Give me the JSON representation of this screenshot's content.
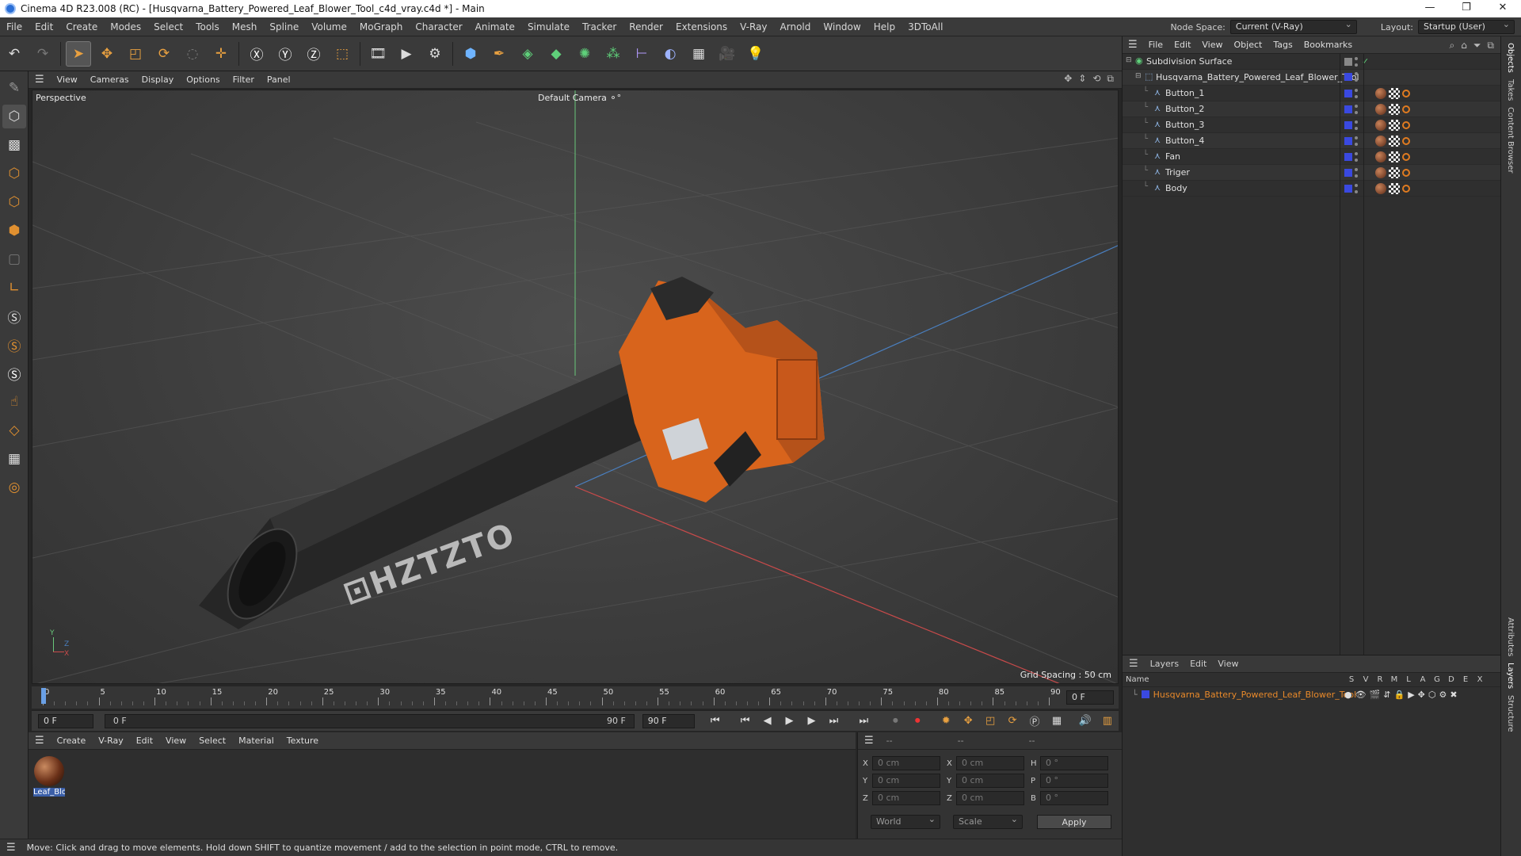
{
  "window": {
    "title": "Cinema 4D R23.008 (RC) - [Husqvarna_Battery_Powered_Leaf_Blower_Tool_c4d_vray.c4d *] - Main",
    "controls": [
      "—",
      "❐",
      "✕"
    ]
  },
  "menubar": {
    "items": [
      "File",
      "Edit",
      "Create",
      "Modes",
      "Select",
      "Tools",
      "Mesh",
      "Spline",
      "Volume",
      "MoGraph",
      "Character",
      "Animate",
      "Simulate",
      "Tracker",
      "Render",
      "Extensions",
      "V-Ray",
      "Arnold",
      "Window",
      "Help",
      "3DToAll"
    ],
    "node_space_label": "Node Space:",
    "node_space_value": "Current (V-Ray)",
    "layout_label": "Layout:",
    "layout_value": "Startup (User)"
  },
  "viewport": {
    "menu": [
      "View",
      "Cameras",
      "Display",
      "Options",
      "Filter",
      "Panel"
    ],
    "view_name": "Perspective",
    "camera_name": "Default Camera",
    "camera_icon": "⚬°",
    "grid_spacing": "Grid Spacing : 50 cm",
    "axis_y": "Y",
    "axis_z": "Z",
    "axis_x": "X"
  },
  "timeline": {
    "ticks": [
      "0",
      "5",
      "10",
      "15",
      "20",
      "25",
      "30",
      "35",
      "40",
      "45",
      "50",
      "55",
      "60",
      "65",
      "70",
      "75",
      "80",
      "85",
      "90"
    ],
    "current_frame": "0 F",
    "start_frame": "0 F",
    "range_start": "0 F",
    "range_end": "90 F",
    "end_frame": "90 F"
  },
  "material": {
    "menu": [
      "Create",
      "V-Ray",
      "Edit",
      "View",
      "Select",
      "Material",
      "Texture"
    ],
    "items": [
      {
        "name": "Leaf_Blo"
      }
    ]
  },
  "coords": {
    "header": [
      "--",
      "--",
      "--"
    ],
    "rows": [
      {
        "a_label": "X",
        "a_val": "0 cm",
        "b_label": "X",
        "b_val": "0 cm",
        "c_label": "H",
        "c_val": "0 °"
      },
      {
        "a_label": "Y",
        "a_val": "0 cm",
        "b_label": "Y",
        "b_val": "0 cm",
        "c_label": "P",
        "c_val": "0 °"
      },
      {
        "a_label": "Z",
        "a_val": "0 cm",
        "b_label": "Z",
        "b_val": "0 cm",
        "c_label": "B",
        "c_val": "0 °"
      }
    ],
    "space": "World",
    "mode": "Scale",
    "apply": "Apply"
  },
  "status": {
    "text": "Move: Click and drag to move elements. Hold down SHIFT to quantize movement / add to the selection in point mode, CTRL to remove."
  },
  "objects": {
    "menu": [
      "File",
      "Edit",
      "View",
      "Object",
      "Tags",
      "Bookmarks"
    ],
    "rows": [
      {
        "name": "Subdivision Surface",
        "indent": 0
      },
      {
        "name": "Husqvarna_Battery_Powered_Leaf_Blower_Tool",
        "indent": 1
      },
      {
        "name": "Button_1",
        "indent": 2
      },
      {
        "name": "Button_2",
        "indent": 2
      },
      {
        "name": "Button_3",
        "indent": 2
      },
      {
        "name": "Button_4",
        "indent": 2
      },
      {
        "name": "Fan",
        "indent": 2
      },
      {
        "name": "Triger",
        "indent": 2
      },
      {
        "name": "Body",
        "indent": 2
      }
    ]
  },
  "layers": {
    "menu": [
      "Layers",
      "Edit",
      "View"
    ],
    "col_name": "Name",
    "cols": [
      "S",
      "V",
      "R",
      "M",
      "L",
      "A",
      "G",
      "D",
      "E",
      "X"
    ],
    "items": [
      {
        "name": "Husqvarna_Battery_Powered_Leaf_Blower_Tool"
      }
    ]
  },
  "rightstrip": {
    "tabs": [
      "Objects",
      "Takes",
      "Content Browser",
      "Attributes",
      "Layers",
      "Structure"
    ]
  },
  "colors": {
    "accent_orange": "#e07b20",
    "layer_blue": "#3a49e0",
    "layer_name_orange": "#e8892a"
  }
}
